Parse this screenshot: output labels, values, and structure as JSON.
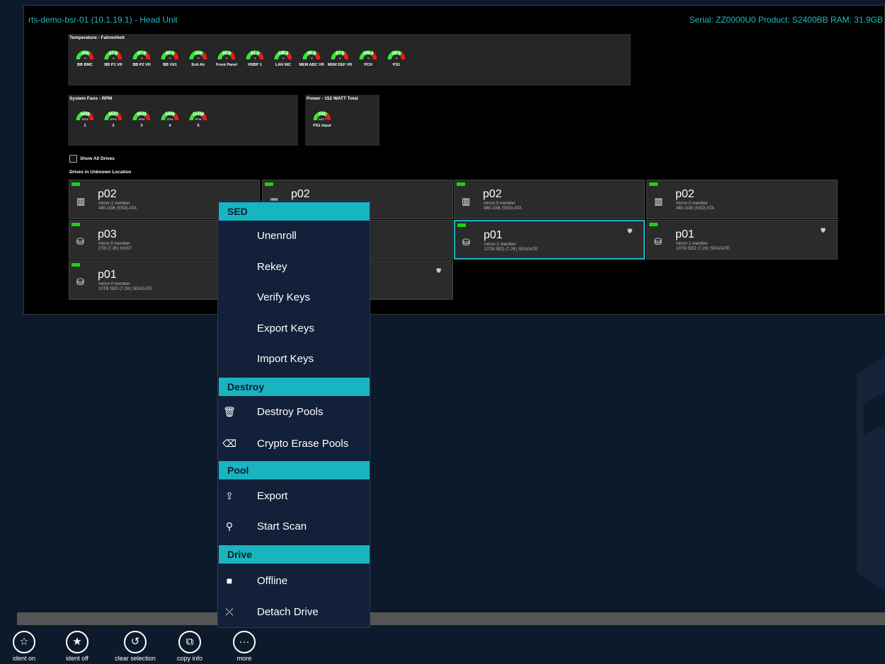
{
  "header": {
    "title": "rts-demo-bsr-01 (10.1.19.1)  -  Head Unit",
    "serial": "Serial:  ZZ0000U0   Product:  S2400BB  RAM:  31.9GB"
  },
  "temperature": {
    "title": "Temperature - Fahrenheit",
    "gauges": [
      {
        "value": "104",
        "unit": "°F",
        "label": "BB BMC"
      },
      {
        "value": "87.8",
        "unit": "°F",
        "label": "BB P1 VR"
      },
      {
        "value": "87.8",
        "unit": "°F",
        "label": "BB P2 VR"
      },
      {
        "value": "89.6",
        "unit": "°F",
        "label": "BB Vtt1"
      },
      {
        "value": "104",
        "unit": "°F",
        "label": "Exit Air"
      },
      {
        "value": "80.6",
        "unit": "°F",
        "label": "Front Panel"
      },
      {
        "value": "91.4",
        "unit": "°F",
        "label": "HSBP 1"
      },
      {
        "value": "140.8",
        "unit": "°F",
        "label": "LAN NIC"
      },
      {
        "value": "96.8",
        "unit": "°F",
        "label": "MEM ABC VR"
      },
      {
        "value": "87.8",
        "unit": "°F",
        "label": "MEM DEF VR"
      },
      {
        "value": "109.4",
        "unit": "°F",
        "label": "PCH"
      },
      {
        "value": "89.6",
        "unit": "°F",
        "label": "PS1"
      }
    ]
  },
  "fans": {
    "title": "System Fans - RPM",
    "gauges": [
      {
        "value": "5439",
        "unit": "RPM",
        "label": "1"
      },
      {
        "value": "5537",
        "unit": "RPM",
        "label": "2"
      },
      {
        "value": "5635",
        "unit": "RPM",
        "label": "3"
      },
      {
        "value": "5488",
        "unit": "RPM",
        "label": "4"
      },
      {
        "value": "11458",
        "unit": "RPM",
        "label": "5"
      }
    ]
  },
  "power": {
    "title": "Power - 152 WATT Total",
    "gauge": {
      "value": "152",
      "unit": "WATT",
      "label": "PS1 Input"
    }
  },
  "show_all_drives": "Show All Drives",
  "drives_section": "Drives in Unknown Location",
  "drives": [
    {
      "icon": "chip-icon",
      "name": "p02",
      "line1": "mirror-1 member",
      "line2": "480.1GB (SSD) ATA",
      "shield": ""
    },
    {
      "icon": "chip-icon",
      "name": "p02",
      "line1": "",
      "line2": "",
      "shield": ""
    },
    {
      "icon": "chip-icon",
      "name": "p02",
      "line1": "mirror-0 member",
      "line2": "480.1GB (SSD) ATA",
      "shield": ""
    },
    {
      "icon": "chip-icon",
      "name": "p02",
      "line1": "mirror-0 member",
      "line2": "480.1GB (SSD) ATA",
      "shield": ""
    },
    {
      "icon": "disk-icon",
      "name": "p03",
      "line1": "mirror-0 member",
      "line2": "2TB (7.2K) HGST",
      "shield": ""
    },
    {
      "icon": "disk-icon",
      "name": "",
      "line1": "",
      "line2": "",
      "shield": ""
    },
    {
      "icon": "disk-icon",
      "name": "p01",
      "line1": "mirror-1 member",
      "line2": "10TB SED (7.2K) SEAGATE",
      "shield": "⛊"
    },
    {
      "icon": "disk-icon",
      "name": "p01",
      "line1": "mirror-1 member",
      "line2": "10TB SED (7.2K) SEAGATE",
      "shield": "⛊"
    },
    {
      "icon": "disk-icon",
      "name": "p01",
      "line1": "mirror-0 member",
      "line2": "10TB SED (7.2K) SEAGATE",
      "shield": ""
    },
    {
      "icon": "disk-icon",
      "name": "",
      "line1": "",
      "line2": "",
      "shield": "⛊"
    }
  ],
  "context_menu": {
    "sed_header": "SED",
    "unenroll": "Unenroll",
    "rekey": "Rekey",
    "verify_keys": "Verify Keys",
    "export_keys": "Export Keys",
    "import_keys": "Import Keys",
    "destroy_header": "Destroy",
    "destroy_pools": "Destroy Pools",
    "crypto_erase": "Crypto Erase Pools",
    "pool_header": "Pool",
    "export": "Export",
    "start_scan": "Start Scan",
    "drive_header": "Drive",
    "offline": "Offline",
    "detach": "Detach Drive"
  },
  "app_bar": {
    "ident_on": "ident on",
    "ident_off": "ident off",
    "clear_selection": "clear selection",
    "copy_info": "copy info",
    "more": "more"
  },
  "colors": {
    "accent": "#18b4bf",
    "led": "#12d612",
    "gauge_green": "#3be23b",
    "gauge_red": "#e02020"
  }
}
